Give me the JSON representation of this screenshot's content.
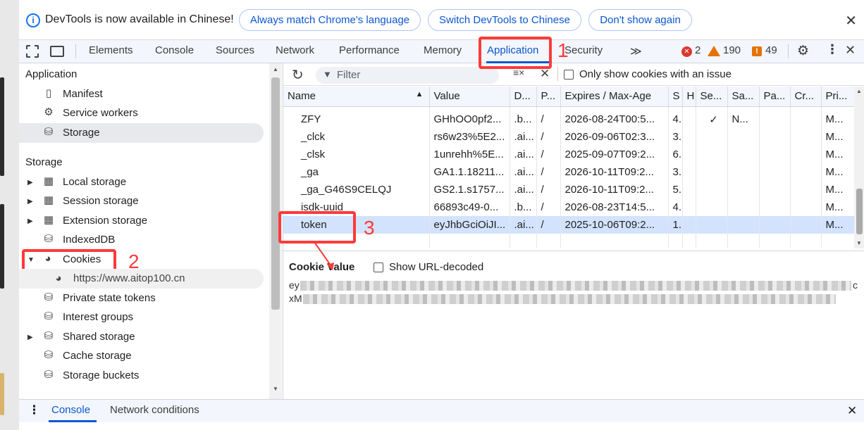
{
  "infobar": {
    "message": "DevTools is now available in Chinese!",
    "btn_match": "Always match Chrome's language",
    "btn_switch": "Switch DevTools to Chinese",
    "btn_dont_show": "Don't show again",
    "close": "✕"
  },
  "tabs": {
    "elements": "Elements",
    "console": "Console",
    "sources": "Sources",
    "network": "Network",
    "performance": "Performance",
    "memory": "Memory",
    "application": "Application",
    "security": "Security",
    "more": "≫",
    "errors_count": "2",
    "warnings_count": "190",
    "issues_count": "49"
  },
  "annotations": {
    "one": "1",
    "two": "2",
    "three": "3"
  },
  "sidebar": {
    "application_header": "Application",
    "manifest": "Manifest",
    "service_workers": "Service workers",
    "storage": "Storage",
    "storage_header": "Storage",
    "local_storage": "Local storage",
    "session_storage": "Session storage",
    "extension_storage": "Extension storage",
    "indexeddb": "IndexedDB",
    "cookies": "Cookies",
    "cookie_origin": "https://www.aitop100.cn",
    "private_state_tokens": "Private state tokens",
    "interest_groups": "Interest groups",
    "shared_storage": "Shared storage",
    "cache_storage": "Cache storage",
    "storage_buckets": "Storage buckets"
  },
  "toolbar": {
    "filter_placeholder": "Filter",
    "only_issues_label": "Only show cookies with an issue"
  },
  "table": {
    "columns": [
      "Name",
      "Value",
      "D...",
      "P...",
      "Expires / Max-Age",
      "S",
      "H",
      "Se...",
      "Sa...",
      "Pa...",
      "Cr...",
      "Pri..."
    ],
    "rows": [
      [
        "ZFY",
        "GHhOO0pf2...",
        ".b...",
        "/",
        "2026-08-24T00:5...",
        "4...",
        "",
        "✓",
        "N...",
        "",
        "",
        "M..."
      ],
      [
        "_clck",
        "rs6w23%5E2...",
        ".ai...",
        "/",
        "2026-09-06T02:3...",
        "3...",
        "",
        "",
        "",
        "",
        "",
        "M..."
      ],
      [
        "_clsk",
        "1unrehh%5E...",
        ".ai...",
        "/",
        "2025-09-07T09:2...",
        "6...",
        "",
        "",
        "",
        "",
        "",
        "M..."
      ],
      [
        "_ga",
        "GA1.1.18211...",
        ".ai...",
        "/",
        "2026-10-11T09:2...",
        "3...",
        "",
        "",
        "",
        "",
        "",
        "M..."
      ],
      [
        "_ga_G46S9CELQJ",
        "GS2.1.s1757...",
        ".ai...",
        "/",
        "2026-10-11T09:2...",
        "5...",
        "",
        "",
        "",
        "",
        "",
        "M..."
      ],
      [
        "isdk-uuid",
        "66893c49-0...",
        ".b...",
        "/",
        "2026-08-23T14:5...",
        "4...",
        "",
        "",
        "",
        "",
        "",
        "M..."
      ],
      [
        "token",
        "eyJhbGciOiJI...",
        ".ai...",
        "/",
        "2025-10-06T09:2...",
        "1...",
        "",
        "",
        "",
        "",
        "",
        "M..."
      ]
    ]
  },
  "value_pane": {
    "title": "Cookie Value",
    "show_decoded": "Show URL-decoded",
    "line1_prefix": "ey",
    "line1_suffix": "c",
    "line2_prefix": "xM"
  },
  "drawer": {
    "console": "Console",
    "network_conditions": "Network conditions"
  }
}
